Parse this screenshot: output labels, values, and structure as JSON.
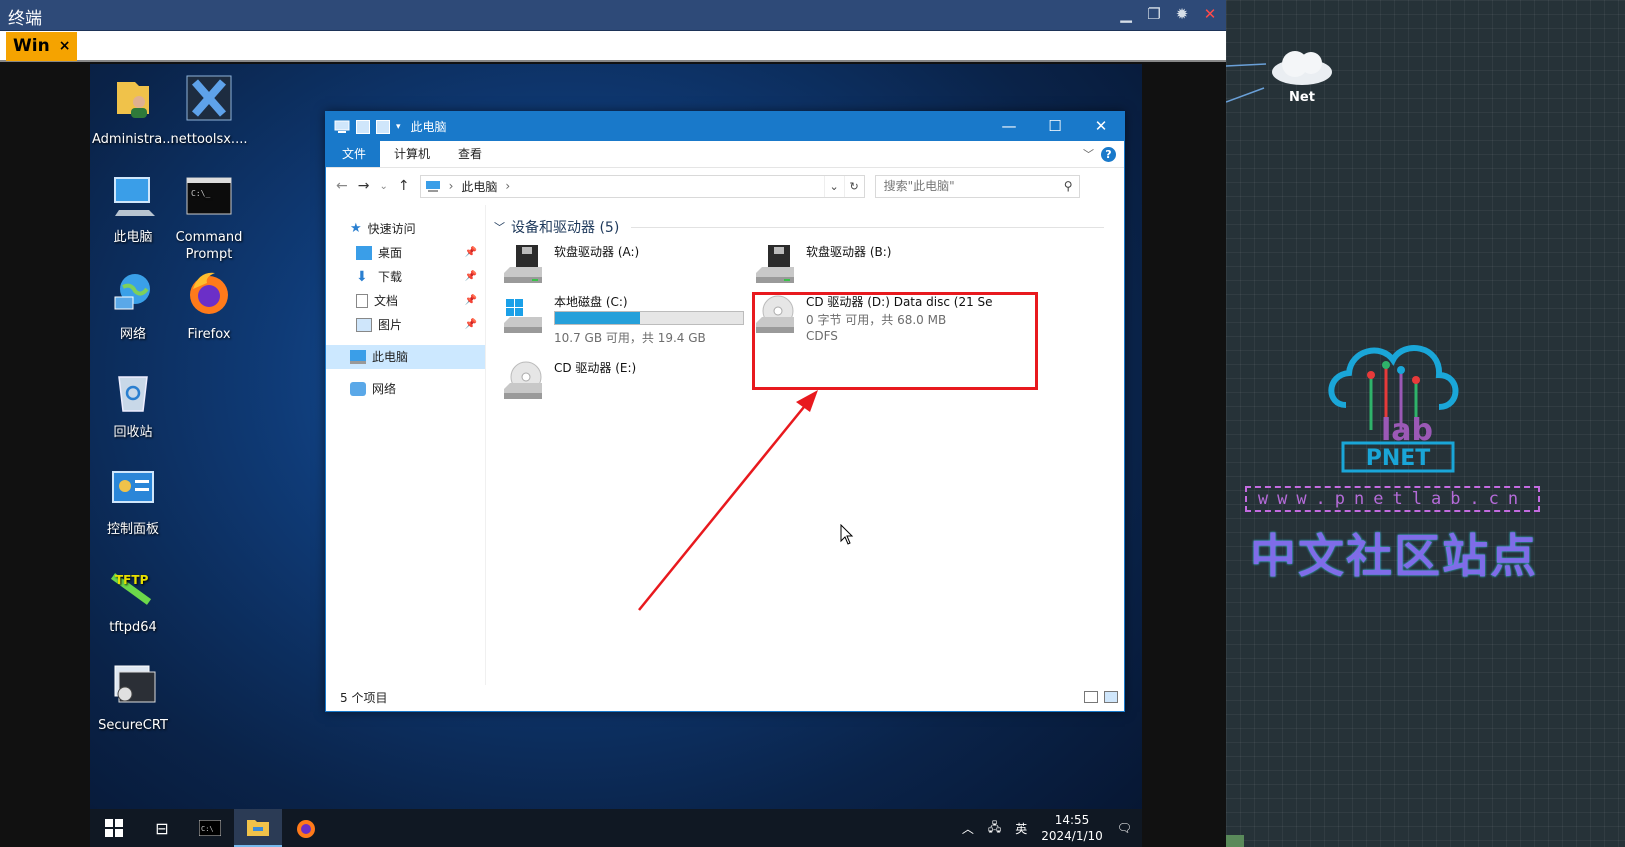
{
  "terminal": {
    "title": "终端",
    "tab_label": "Win",
    "tab_close": "×"
  },
  "lab": {
    "net_label": "Net",
    "logo_text": "PNET",
    "logo_lab": "lab",
    "url": "www.pnetlab.cn",
    "slogan": "中文社区站点"
  },
  "desktop_icons": [
    {
      "label": "Administra...",
      "icon": "user-folder-icon"
    },
    {
      "label": "nettoolsx....",
      "icon": "nettools-icon"
    },
    {
      "label": "此电脑",
      "icon": "this-pc-icon"
    },
    {
      "label": "Command Prompt",
      "icon": "command-prompt-icon"
    },
    {
      "label": "网络",
      "icon": "network-icon"
    },
    {
      "label": "Firefox",
      "icon": "firefox-icon"
    },
    {
      "label": "回收站",
      "icon": "recycle-bin-icon"
    },
    {
      "label": "控制面板",
      "icon": "control-panel-icon"
    },
    {
      "label": "tftpd64",
      "icon": "tftpd-icon"
    },
    {
      "label": "SecureCRT",
      "icon": "securecrt-icon"
    }
  ],
  "explorer": {
    "title": "此电脑",
    "ribbon_tabs": [
      "文件",
      "计算机",
      "查看"
    ],
    "address": "此电脑",
    "search_placeholder": "搜索\"此电脑\"",
    "nav": [
      {
        "label": "快速访问"
      },
      {
        "label": "桌面"
      },
      {
        "label": "下载"
      },
      {
        "label": "文档"
      },
      {
        "label": "图片"
      },
      {
        "label": "此电脑"
      },
      {
        "label": "网络"
      }
    ],
    "group_header": "设备和驱动器 (5)",
    "drives": [
      {
        "name": "软盘驱动器 (A:)"
      },
      {
        "name": "软盘驱动器 (B:)"
      },
      {
        "name": "本地磁盘 (C:)",
        "space": "10.7 GB 可用，共 19.4 GB",
        "used_fraction": 0.45
      },
      {
        "name": "CD 驱动器 (D:) Data disc (21 Se",
        "space": "0 字节 可用，共 68.0 MB",
        "fs": "CDFS"
      },
      {
        "name": "CD 驱动器 (E:)"
      }
    ],
    "status": "5 个项目"
  },
  "taskbar": {
    "ime": "英",
    "time": "14:55",
    "date": "2024/1/10"
  },
  "colors": {
    "accent": "#1979ca",
    "highlight": "#e8191e",
    "terminal_tab": "#f5a300"
  }
}
